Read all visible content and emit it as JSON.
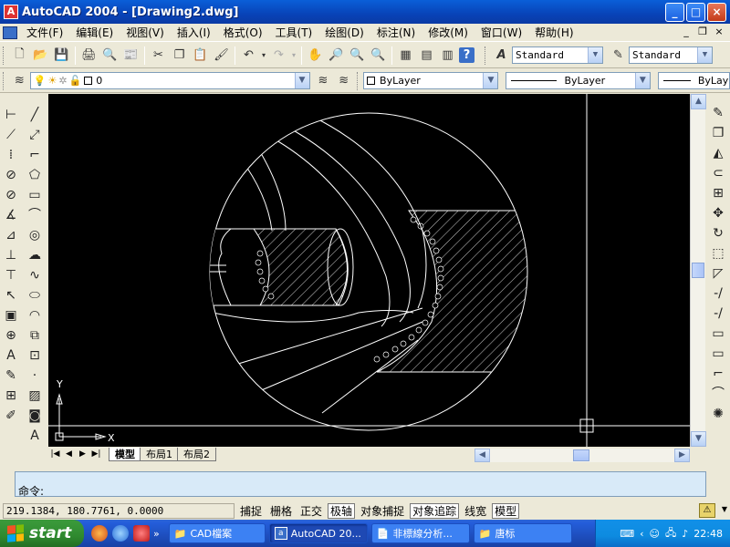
{
  "window": {
    "title": "AutoCAD 2004 - [Drawing2.dwg]",
    "app_icon": "autocad-icon",
    "controls": {
      "minimize": "_",
      "maximize": "□",
      "close": "×"
    }
  },
  "menubar": {
    "items": [
      "文件(F)",
      "编辑(E)",
      "视图(V)",
      "插入(I)",
      "格式(O)",
      "工具(T)",
      "绘图(D)",
      "标注(N)",
      "修改(M)",
      "窗口(W)",
      "帮助(H)"
    ],
    "mdi_controls": {
      "minimize": "_",
      "restore": "❐",
      "close": "×"
    }
  },
  "toolbar_standard": {
    "text_style": "Standard",
    "dim_style": "Standard"
  },
  "toolbar_layers": {
    "layer_name": "0",
    "color": "ByLayer",
    "linetype": "ByLayer",
    "lineweight": "ByLay"
  },
  "canvas": {
    "background": "#000000",
    "ucs_x_label": "X",
    "ucs_y_label": "Y"
  },
  "layout_tabs": {
    "tabs": [
      "模型",
      "布局1",
      "布局2"
    ],
    "active": "模型"
  },
  "command": {
    "prompt": "命令:"
  },
  "status": {
    "coordinates": "219.1384, 180.7761, 0.0000",
    "toggles": [
      {
        "label": "捕捉",
        "on": false
      },
      {
        "label": "栅格",
        "on": false
      },
      {
        "label": "正交",
        "on": false
      },
      {
        "label": "极轴",
        "on": true
      },
      {
        "label": "对象捕捉",
        "on": false
      },
      {
        "label": "对象追踪",
        "on": true
      },
      {
        "label": "线宽",
        "on": false
      },
      {
        "label": "模型",
        "on": true
      }
    ]
  },
  "taskbar": {
    "start_label": "start",
    "tasks": [
      {
        "label": "CAD檔案",
        "icon": "folder-icon",
        "active": false
      },
      {
        "label": "AutoCAD 20...",
        "icon": "autocad-icon",
        "active": true
      },
      {
        "label": "非標線分析...",
        "icon": "document-icon",
        "active": false
      },
      {
        "label": "唐标",
        "icon": "folder-icon",
        "active": false
      }
    ],
    "clock": "22:48"
  }
}
